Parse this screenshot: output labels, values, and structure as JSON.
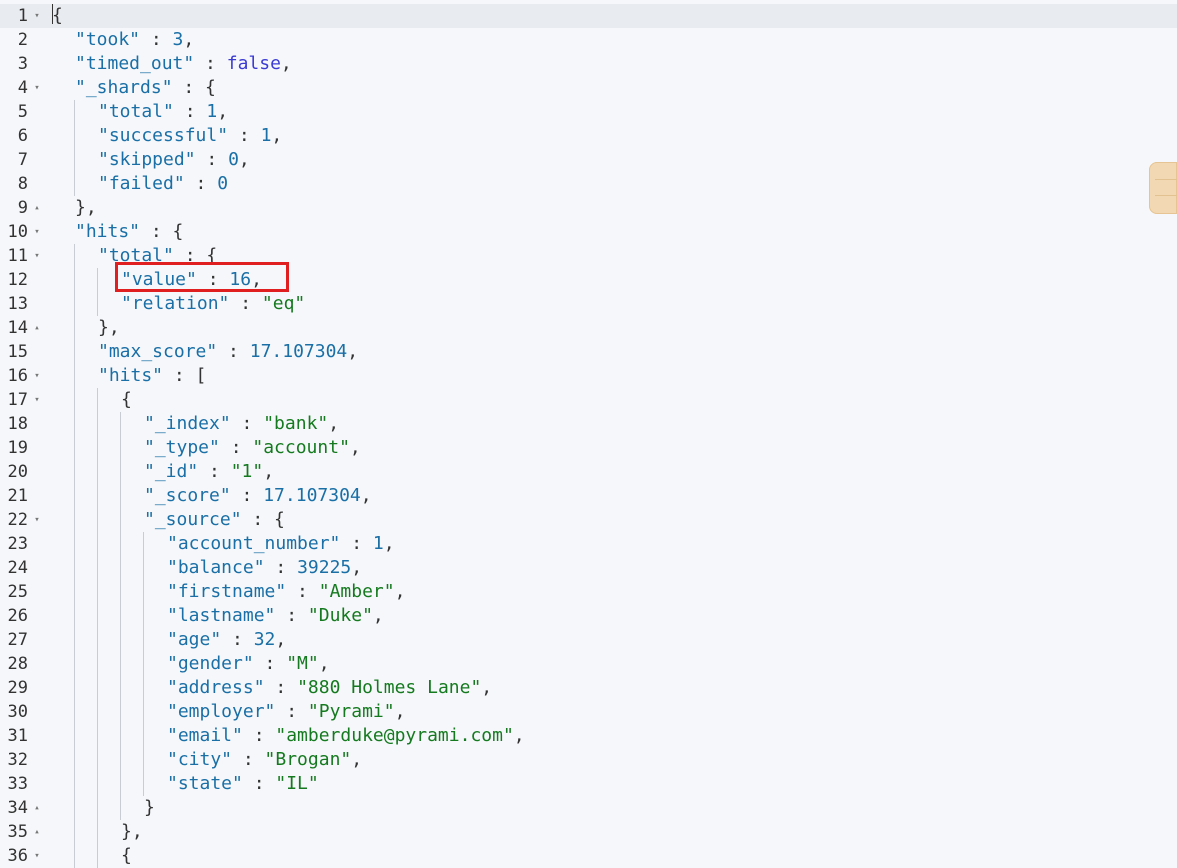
{
  "editor": {
    "lines": [
      {
        "n": "1",
        "fold": "down",
        "indent": 0,
        "tokens": [
          [
            "p",
            "{"
          ]
        ]
      },
      {
        "n": "2",
        "fold": "",
        "indent": 1,
        "tokens": [
          [
            "k",
            "\"took\""
          ],
          [
            "p",
            " : "
          ],
          [
            "n",
            "3"
          ],
          [
            "p",
            ","
          ]
        ]
      },
      {
        "n": "3",
        "fold": "",
        "indent": 1,
        "tokens": [
          [
            "k",
            "\"timed_out\""
          ],
          [
            "p",
            " : "
          ],
          [
            "b",
            "false"
          ],
          [
            "p",
            ","
          ]
        ]
      },
      {
        "n": "4",
        "fold": "down",
        "indent": 1,
        "tokens": [
          [
            "k",
            "\"_shards\""
          ],
          [
            "p",
            " : {"
          ]
        ]
      },
      {
        "n": "5",
        "fold": "",
        "indent": 2,
        "tokens": [
          [
            "k",
            "\"total\""
          ],
          [
            "p",
            " : "
          ],
          [
            "n",
            "1"
          ],
          [
            "p",
            ","
          ]
        ]
      },
      {
        "n": "6",
        "fold": "",
        "indent": 2,
        "tokens": [
          [
            "k",
            "\"successful\""
          ],
          [
            "p",
            " : "
          ],
          [
            "n",
            "1"
          ],
          [
            "p",
            ","
          ]
        ]
      },
      {
        "n": "7",
        "fold": "",
        "indent": 2,
        "tokens": [
          [
            "k",
            "\"skipped\""
          ],
          [
            "p",
            " : "
          ],
          [
            "n",
            "0"
          ],
          [
            "p",
            ","
          ]
        ]
      },
      {
        "n": "8",
        "fold": "",
        "indent": 2,
        "tokens": [
          [
            "k",
            "\"failed\""
          ],
          [
            "p",
            " : "
          ],
          [
            "n",
            "0"
          ]
        ]
      },
      {
        "n": "9",
        "fold": "up",
        "indent": 1,
        "tokens": [
          [
            "p",
            "},"
          ]
        ]
      },
      {
        "n": "10",
        "fold": "down",
        "indent": 1,
        "tokens": [
          [
            "k",
            "\"hits\""
          ],
          [
            "p",
            " : {"
          ]
        ]
      },
      {
        "n": "11",
        "fold": "down",
        "indent": 2,
        "tokens": [
          [
            "k",
            "\"total\""
          ],
          [
            "p",
            " : {"
          ]
        ]
      },
      {
        "n": "12",
        "fold": "",
        "indent": 3,
        "tokens": [
          [
            "k",
            "\"value\""
          ],
          [
            "p",
            " : "
          ],
          [
            "n",
            "16"
          ],
          [
            "p",
            ","
          ]
        ]
      },
      {
        "n": "13",
        "fold": "",
        "indent": 3,
        "tokens": [
          [
            "k",
            "\"relation\""
          ],
          [
            "p",
            " : "
          ],
          [
            "s",
            "\"eq\""
          ]
        ]
      },
      {
        "n": "14",
        "fold": "up",
        "indent": 2,
        "tokens": [
          [
            "p",
            "},"
          ]
        ]
      },
      {
        "n": "15",
        "fold": "",
        "indent": 2,
        "tokens": [
          [
            "k",
            "\"max_score\""
          ],
          [
            "p",
            " : "
          ],
          [
            "n",
            "17.107304"
          ],
          [
            "p",
            ","
          ]
        ]
      },
      {
        "n": "16",
        "fold": "down",
        "indent": 2,
        "tokens": [
          [
            "k",
            "\"hits\""
          ],
          [
            "p",
            " : ["
          ]
        ]
      },
      {
        "n": "17",
        "fold": "down",
        "indent": 3,
        "tokens": [
          [
            "p",
            "{"
          ]
        ]
      },
      {
        "n": "18",
        "fold": "",
        "indent": 4,
        "tokens": [
          [
            "k",
            "\"_index\""
          ],
          [
            "p",
            " : "
          ],
          [
            "s",
            "\"bank\""
          ],
          [
            "p",
            ","
          ]
        ]
      },
      {
        "n": "19",
        "fold": "",
        "indent": 4,
        "tokens": [
          [
            "k",
            "\"_type\""
          ],
          [
            "p",
            " : "
          ],
          [
            "s",
            "\"account\""
          ],
          [
            "p",
            ","
          ]
        ]
      },
      {
        "n": "20",
        "fold": "",
        "indent": 4,
        "tokens": [
          [
            "k",
            "\"_id\""
          ],
          [
            "p",
            " : "
          ],
          [
            "s",
            "\"1\""
          ],
          [
            "p",
            ","
          ]
        ]
      },
      {
        "n": "21",
        "fold": "",
        "indent": 4,
        "tokens": [
          [
            "k",
            "\"_score\""
          ],
          [
            "p",
            " : "
          ],
          [
            "n",
            "17.107304"
          ],
          [
            "p",
            ","
          ]
        ]
      },
      {
        "n": "22",
        "fold": "down",
        "indent": 4,
        "tokens": [
          [
            "k",
            "\"_source\""
          ],
          [
            "p",
            " : {"
          ]
        ]
      },
      {
        "n": "23",
        "fold": "",
        "indent": 5,
        "tokens": [
          [
            "k",
            "\"account_number\""
          ],
          [
            "p",
            " : "
          ],
          [
            "n",
            "1"
          ],
          [
            "p",
            ","
          ]
        ]
      },
      {
        "n": "24",
        "fold": "",
        "indent": 5,
        "tokens": [
          [
            "k",
            "\"balance\""
          ],
          [
            "p",
            " : "
          ],
          [
            "n",
            "39225"
          ],
          [
            "p",
            ","
          ]
        ]
      },
      {
        "n": "25",
        "fold": "",
        "indent": 5,
        "tokens": [
          [
            "k",
            "\"firstname\""
          ],
          [
            "p",
            " : "
          ],
          [
            "s",
            "\"Amber\""
          ],
          [
            "p",
            ","
          ]
        ]
      },
      {
        "n": "26",
        "fold": "",
        "indent": 5,
        "tokens": [
          [
            "k",
            "\"lastname\""
          ],
          [
            "p",
            " : "
          ],
          [
            "s",
            "\"Duke\""
          ],
          [
            "p",
            ","
          ]
        ]
      },
      {
        "n": "27",
        "fold": "",
        "indent": 5,
        "tokens": [
          [
            "k",
            "\"age\""
          ],
          [
            "p",
            " : "
          ],
          [
            "n",
            "32"
          ],
          [
            "p",
            ","
          ]
        ]
      },
      {
        "n": "28",
        "fold": "",
        "indent": 5,
        "tokens": [
          [
            "k",
            "\"gender\""
          ],
          [
            "p",
            " : "
          ],
          [
            "s",
            "\"M\""
          ],
          [
            "p",
            ","
          ]
        ]
      },
      {
        "n": "29",
        "fold": "",
        "indent": 5,
        "tokens": [
          [
            "k",
            "\"address\""
          ],
          [
            "p",
            " : "
          ],
          [
            "s",
            "\"880 Holmes Lane\""
          ],
          [
            "p",
            ","
          ]
        ]
      },
      {
        "n": "30",
        "fold": "",
        "indent": 5,
        "tokens": [
          [
            "k",
            "\"employer\""
          ],
          [
            "p",
            " : "
          ],
          [
            "s",
            "\"Pyrami\""
          ],
          [
            "p",
            ","
          ]
        ]
      },
      {
        "n": "31",
        "fold": "",
        "indent": 5,
        "tokens": [
          [
            "k",
            "\"email\""
          ],
          [
            "p",
            " : "
          ],
          [
            "s",
            "\"amberduke@pyrami.com\""
          ],
          [
            "p",
            ","
          ]
        ]
      },
      {
        "n": "32",
        "fold": "",
        "indent": 5,
        "tokens": [
          [
            "k",
            "\"city\""
          ],
          [
            "p",
            " : "
          ],
          [
            "s",
            "\"Brogan\""
          ],
          [
            "p",
            ","
          ]
        ]
      },
      {
        "n": "33",
        "fold": "",
        "indent": 5,
        "tokens": [
          [
            "k",
            "\"state\""
          ],
          [
            "p",
            " : "
          ],
          [
            "s",
            "\"IL\""
          ]
        ]
      },
      {
        "n": "34",
        "fold": "up",
        "indent": 4,
        "tokens": [
          [
            "p",
            "}"
          ]
        ]
      },
      {
        "n": "35",
        "fold": "up",
        "indent": 3,
        "tokens": [
          [
            "p",
            "},"
          ]
        ]
      },
      {
        "n": "36",
        "fold": "down",
        "indent": 3,
        "tokens": [
          [
            "p",
            "{"
          ]
        ]
      }
    ],
    "colors": {
      "key": "#1a6fa6",
      "string": "#157a1f",
      "number": "#1a6fa6",
      "boolean": "#3b3bd4",
      "punct": "#333333",
      "highlight": "#e02020"
    },
    "highlighted_line": "12",
    "active_line": "1"
  }
}
